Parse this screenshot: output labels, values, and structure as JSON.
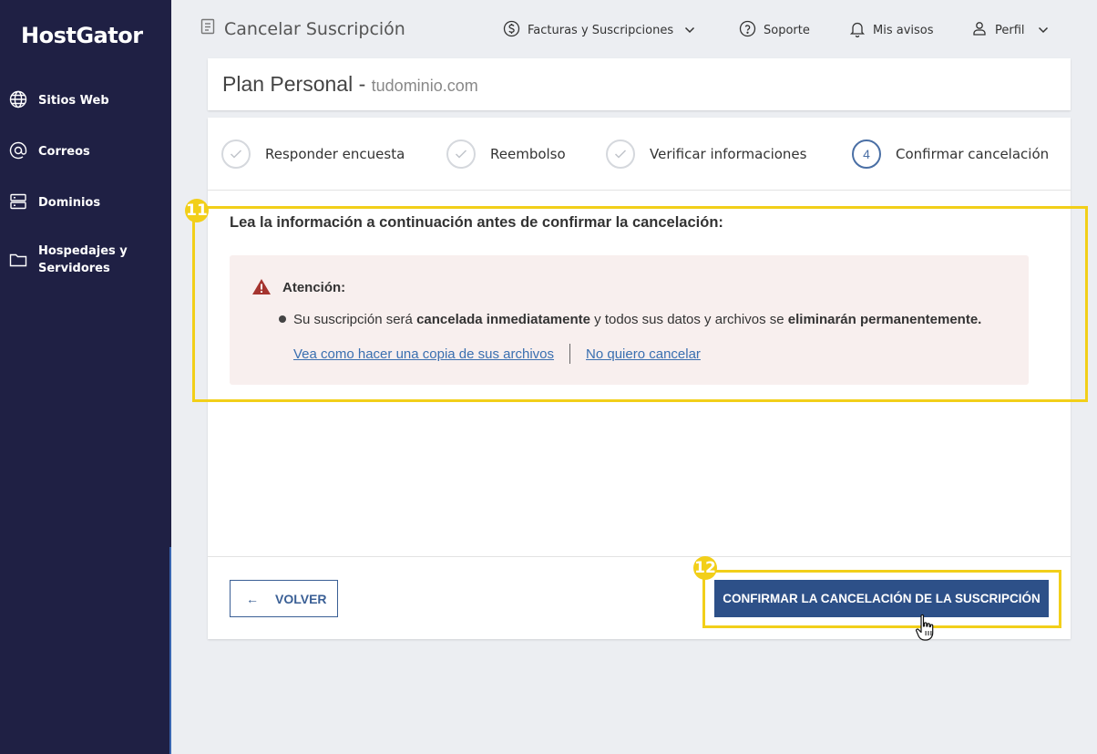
{
  "sidebar": {
    "logo": "HostGator",
    "items": [
      {
        "label": "Sitios Web",
        "icon": "globe-icon"
      },
      {
        "label": "Correos",
        "icon": "at-icon"
      },
      {
        "label": "Dominios",
        "icon": "server-icon"
      },
      {
        "label": "Hospedajes y Servidores",
        "icon": "folder-icon"
      }
    ]
  },
  "header": {
    "title": "Cancelar Suscripción",
    "nav": {
      "billing": "Facturas y Suscripciones",
      "support": "Soporte",
      "notices": "Mis avisos",
      "profile": "Perfil"
    }
  },
  "plan": {
    "name": "Plan Personal",
    "separator": "-",
    "domain": "tudominio.com"
  },
  "steps": [
    {
      "label": "Responder encuesta",
      "state": "done"
    },
    {
      "label": "Reembolso",
      "state": "done"
    },
    {
      "label": "Verificar informaciones",
      "state": "done"
    },
    {
      "label": "Confirmar cancelación",
      "state": "active",
      "number": "4"
    }
  ],
  "content": {
    "heading": "Lea la información a continuación antes de confirmar la cancelación:",
    "alert": {
      "title": "Atención:",
      "msg_part1": "Su suscripción será ",
      "msg_bold1": "cancelada inmediatamente",
      "msg_part2": " y todos sus datos y archivos se ",
      "msg_bold2": "eliminarán permanentemente.",
      "link_backup": "Vea como hacer una copia de sus archivos",
      "link_keep": "No quiero cancelar"
    }
  },
  "actions": {
    "back_arrow": "←",
    "back": "VOLVER",
    "confirm": "CONFIRMAR LA CANCELACIÓN DE LA SUSCRIPCIÓN"
  },
  "annotations": {
    "badge_11": "11",
    "badge_12": "12"
  },
  "colors": {
    "sidebar_bg": "#1f2044",
    "primary": "#2d5088",
    "highlight": "#f2cf19",
    "alert_bg": "#f8efee",
    "warning_icon": "#a5342f"
  }
}
